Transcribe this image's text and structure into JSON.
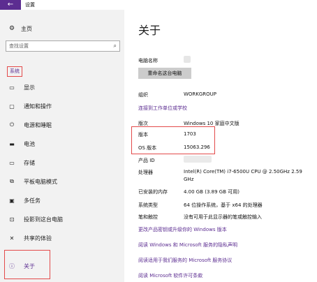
{
  "window": {
    "title": "设置",
    "back_icon": "←"
  },
  "sidebar": {
    "home_label": "主页",
    "search_placeholder": "查找设置",
    "section_label": "系统",
    "items": [
      {
        "label": "显示",
        "icon": "display-icon"
      },
      {
        "label": "通知和操作",
        "icon": "notification-icon"
      },
      {
        "label": "电源和睡眠",
        "icon": "power-icon"
      },
      {
        "label": "电池",
        "icon": "battery-icon"
      },
      {
        "label": "存储",
        "icon": "storage-icon"
      },
      {
        "label": "平板电脑模式",
        "icon": "tablet-icon"
      },
      {
        "label": "多任务",
        "icon": "multitask-icon"
      },
      {
        "label": "投影到这台电脑",
        "icon": "project-icon"
      },
      {
        "label": "共享的体验",
        "icon": "share-icon"
      },
      {
        "label": "关于",
        "icon": "info-icon",
        "active": true
      }
    ]
  },
  "main": {
    "title": "关于",
    "pc_name_label": "电脑名称",
    "rename_button": "重命名这台电脑",
    "org_label": "组织",
    "org_value": "WORKGROUP",
    "connect_link": "连接到工作单位或学校",
    "edition_label": "版次",
    "edition_value": "Windows 10 家庭中文版",
    "version_label": "版本",
    "version_value": "1703",
    "build_label": "OS 版本",
    "build_value": "15063.296",
    "product_id_label": "产品 ID",
    "processor_label": "处理器",
    "processor_value_line1": "Intel(R) Core(TM) i7-6500U CPU @ 2.50GHz   2.59",
    "processor_value_line2": "GHz",
    "ram_label": "已安装的内存",
    "ram_value": "4.00 GB (3.89 GB 可用)",
    "system_type_label": "系统类型",
    "system_type_value": "64 位操作系统，基于 x64 的处理器",
    "pen_label": "笔和触控",
    "pen_value": "没有可用于此显示器的笔或触控输入",
    "links": [
      "更改产品密钥或升级你的 Windows 版本",
      "阅读 Windows 和 Microsoft 服务的隐私声明",
      "阅读适用于我们服务的 Microsoft 服务协议",
      "阅读 Microsoft 软件许可条款"
    ]
  },
  "colors": {
    "accent": "#5c2d91",
    "highlight_box": "#e34a4a",
    "sidebar_bg": "#f2f2f2"
  }
}
